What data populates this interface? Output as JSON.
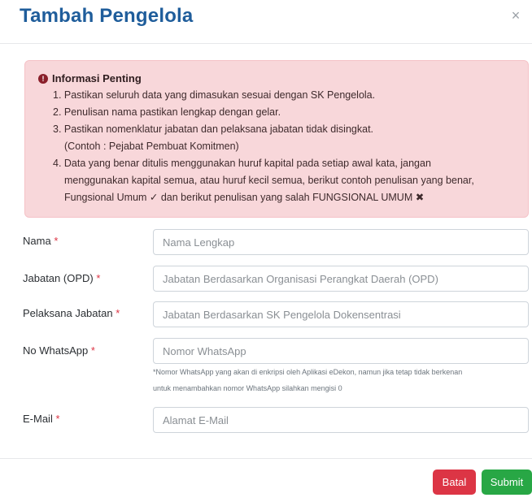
{
  "modal": {
    "title": "Tambah Pengelola",
    "close_glyph": "×"
  },
  "alert": {
    "icon": "info-circle-icon",
    "title": "Informasi Penting",
    "lines": [
      "1. Pastikan seluruh data yang dimasukan sesuai dengan SK Pengelola.",
      "2. Penulisan nama pastikan lengkap dengan gelar.",
      "3. Pastikan nomenklatur jabatan dan pelaksana jabatan tidak disingkat.",
      "(Contoh : Pejabat Pembuat Komitmen)",
      "4. Data yang benar ditulis menggunakan huruf kapital pada setiap awal kata, jangan",
      "menggunakan kapital semua, atau huruf kecil semua, berikut contoh penulisan yang benar,",
      "Fungsional Umum ✓ dan berikut penulisan yang salah FUNGSIONAL UMUM ✖"
    ],
    "colors": {
      "background": "#f8d7da",
      "border": "#f5c2c7"
    }
  },
  "form": {
    "required_mark": "*",
    "nama": {
      "label": "Nama",
      "placeholder": "Nama Lengkap",
      "value": ""
    },
    "jabatan": {
      "label": "Jabatan (OPD)",
      "placeholder": "Jabatan Berdasarkan Organisasi Perangkat Daerah (OPD)",
      "value": ""
    },
    "pelaksana": {
      "label": "Pelaksana Jabatan",
      "placeholder": "Jabatan Berdasarkan SK Pengelola Dokensentrasi",
      "value": ""
    },
    "whatsapp": {
      "label": "No WhatsApp",
      "placeholder": "Nomor WhatsApp",
      "value": "",
      "help_line1": "*Nomor WhatsApp yang akan di enkripsi oleh Aplikasi eDekon, namun jika tetap tidak berkenan",
      "help_line2": "untuk menambahkan nomor WhatsApp silahkan mengisi 0"
    },
    "email": {
      "label": "E-Mail",
      "placeholder": "Alamat E-Mail",
      "value": ""
    }
  },
  "footer": {
    "cancel_label": "Batal",
    "submit_label": "Submit",
    "colors": {
      "cancel": "#dc3545",
      "submit": "#28a745",
      "title": "#1f5d9b"
    }
  }
}
